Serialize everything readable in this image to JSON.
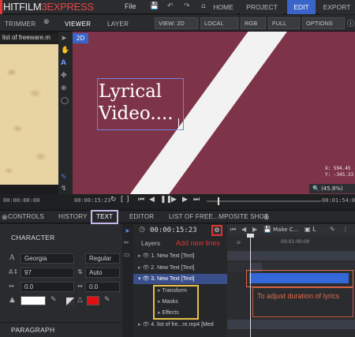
{
  "app": {
    "logo_prefix": "HITFILM",
    "logo_num": "3",
    "logo_suffix": "EXPRESS",
    "menu_file": "File"
  },
  "top_tabs": {
    "home": "HOME",
    "project": "PROJECT",
    "edit": "EDIT",
    "export": "EXPORT"
  },
  "panel_tabs": {
    "trimmer": "TRIMMER",
    "viewer": "VIEWER",
    "layer": "LAYER"
  },
  "viewer_controls": {
    "view": "VIEW: 2D",
    "space": "LOCAL",
    "channel": "RGB",
    "quality": "FULL",
    "options": "OPTIONS"
  },
  "trimmer": {
    "clip_name": "list of freeware.m",
    "time": "00:00:00:00"
  },
  "viewer": {
    "mode_badge": "2D",
    "text_line1": "Lyrical",
    "text_line2": "Video....",
    "coord_x": "X:   594.45",
    "coord_y": "Y:  -345.33",
    "zoom": "(45.8%)"
  },
  "transport": {
    "time_current": "00:00:15:23",
    "time_end": "00:01:54:00"
  },
  "bottom_tabs": {
    "controls": "CONTROLS",
    "history": "HISTORY",
    "text": "TEXT",
    "editor": "EDITOR",
    "composite": "LIST OF FREE...MPOSITE SHOT"
  },
  "character": {
    "heading": "CHARACTER",
    "font": "Georgia",
    "style": "Regular",
    "size": "97",
    "leading": "Auto",
    "tracking": "0.0",
    "kerning": "0.0",
    "fill_color": "#ffffff",
    "stroke_color": "#e01010"
  },
  "paragraph": {
    "heading": "PARAGRAPH"
  },
  "editor": {
    "time": "00:00:15:23",
    "layers_label": "Layers",
    "make_comp": "Make C...",
    "ruler_mark": "00:01:00:00",
    "layers": [
      "1. New Text [Text]",
      "2. New Text [Text]",
      "3. New Text [Text]",
      "4. list of fre...re.mp4 [Med"
    ],
    "sub_items": [
      "Transform",
      "Masks",
      "Effects"
    ]
  },
  "annotations": {
    "add_lines": "Add new lines",
    "duration": "To adjust duration of lyrics"
  },
  "colors": {
    "accent": "#3a64c8",
    "viewer_bg": "#7e3448",
    "annotation_red": "#e23434",
    "annotation_orange": "#e26a4a",
    "annotation_yellow": "#e6c04a",
    "timeline_bar": "#3467d8"
  }
}
